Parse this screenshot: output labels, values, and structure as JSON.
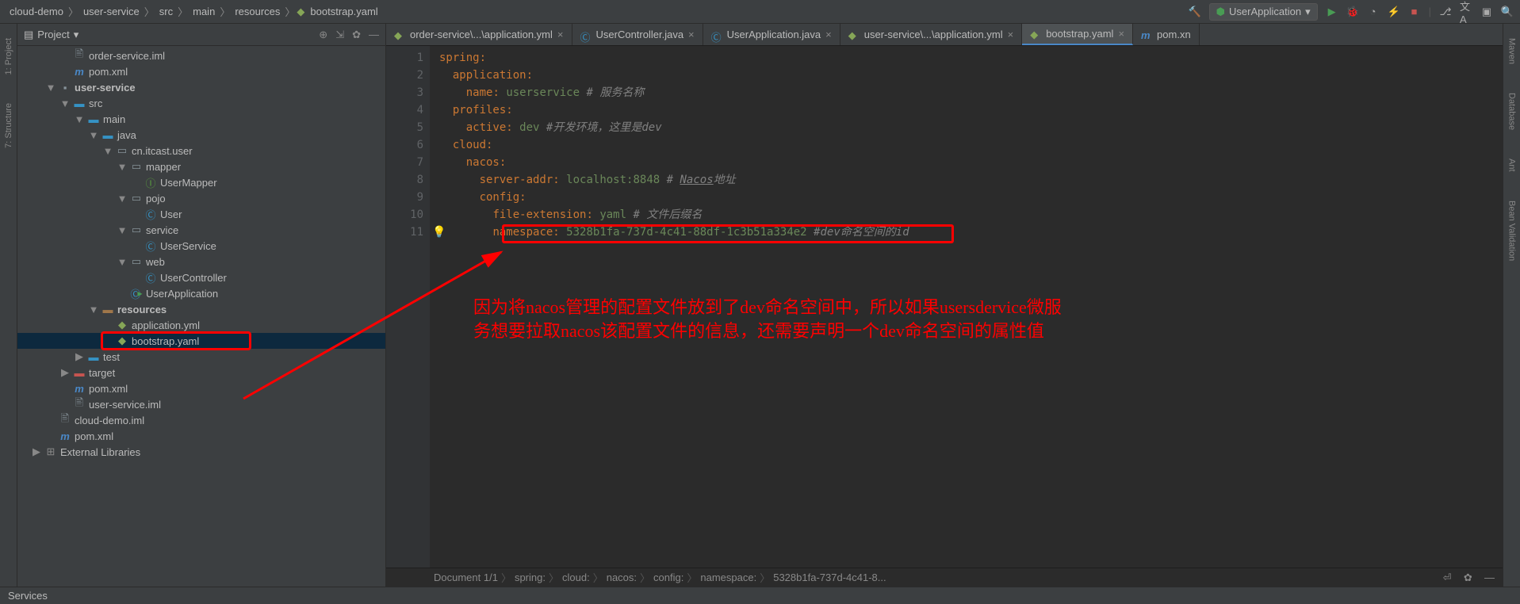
{
  "breadcrumb": [
    "cloud-demo",
    "user-service",
    "src",
    "main",
    "resources",
    "bootstrap.yaml"
  ],
  "run_config": "UserApplication",
  "project_panel": {
    "title": "Project"
  },
  "tree": [
    {
      "d": 3,
      "arrow": "",
      "icon": "folder",
      "label": "order-service.iml"
    },
    {
      "d": 3,
      "arrow": "",
      "icon": "m",
      "label": "pom.xml",
      "color": "#4a88c7"
    },
    {
      "d": 2,
      "arrow": "▼",
      "icon": "module",
      "label": "user-service",
      "bold": true
    },
    {
      "d": 3,
      "arrow": "▼",
      "icon": "src",
      "label": "src"
    },
    {
      "d": 4,
      "arrow": "▼",
      "icon": "src",
      "label": "main"
    },
    {
      "d": 5,
      "arrow": "▼",
      "icon": "src",
      "label": "java"
    },
    {
      "d": 6,
      "arrow": "▼",
      "icon": "pkg",
      "label": "cn.itcast.user"
    },
    {
      "d": 7,
      "arrow": "▼",
      "icon": "pkg",
      "label": "mapper"
    },
    {
      "d": 8,
      "arrow": "",
      "icon": "interface",
      "label": "UserMapper"
    },
    {
      "d": 7,
      "arrow": "▼",
      "icon": "pkg",
      "label": "pojo"
    },
    {
      "d": 8,
      "arrow": "",
      "icon": "class",
      "label": "User"
    },
    {
      "d": 7,
      "arrow": "▼",
      "icon": "pkg",
      "label": "service"
    },
    {
      "d": 8,
      "arrow": "",
      "icon": "class",
      "label": "UserService"
    },
    {
      "d": 7,
      "arrow": "▼",
      "icon": "pkg",
      "label": "web"
    },
    {
      "d": 8,
      "arrow": "",
      "icon": "class",
      "label": "UserController"
    },
    {
      "d": 7,
      "arrow": "",
      "icon": "class-run",
      "label": "UserApplication"
    },
    {
      "d": 5,
      "arrow": "▼",
      "icon": "res",
      "label": "resources",
      "bold": true
    },
    {
      "d": 6,
      "arrow": "",
      "icon": "yaml",
      "label": "application.yml"
    },
    {
      "d": 6,
      "arrow": "",
      "icon": "yaml",
      "label": "bootstrap.yaml",
      "selected": true
    },
    {
      "d": 4,
      "arrow": "▶",
      "icon": "src",
      "label": "test"
    },
    {
      "d": 3,
      "arrow": "▶",
      "icon": "target",
      "label": "target"
    },
    {
      "d": 3,
      "arrow": "",
      "icon": "m",
      "label": "pom.xml",
      "color": "#4a88c7"
    },
    {
      "d": 3,
      "arrow": "",
      "icon": "folder",
      "label": "user-service.iml"
    },
    {
      "d": 2,
      "arrow": "",
      "icon": "folder",
      "label": "cloud-demo.iml"
    },
    {
      "d": 2,
      "arrow": "",
      "icon": "m",
      "label": "pom.xml",
      "color": "#4a88c7"
    },
    {
      "d": 1,
      "arrow": "▶",
      "icon": "lib",
      "label": "External Libraries"
    }
  ],
  "tabs": [
    {
      "icon": "yaml",
      "label": "order-service\\...\\application.yml",
      "close": true
    },
    {
      "icon": "class",
      "label": "UserController.java",
      "close": true
    },
    {
      "icon": "class-run",
      "label": "UserApplication.java",
      "close": true
    },
    {
      "icon": "yaml",
      "label": "user-service\\...\\application.yml",
      "close": true
    },
    {
      "icon": "yaml",
      "label": "bootstrap.yaml",
      "close": true,
      "active": true
    },
    {
      "icon": "m",
      "label": "pom.xn",
      "close": false
    }
  ],
  "code": {
    "lines": [
      {
        "n": 1,
        "html": "<span class='k'>spring</span><span class='col'>:</span>"
      },
      {
        "n": 2,
        "html": "  <span class='k'>application</span><span class='col'>:</span>"
      },
      {
        "n": 3,
        "html": "    <span class='k'>name</span><span class='col'>:</span> <span class='s'>userservice</span> <span class='c'># 服务名称</span>"
      },
      {
        "n": 4,
        "html": "  <span class='k'>profiles</span><span class='col'>:</span>"
      },
      {
        "n": 5,
        "html": "    <span class='k'>active</span><span class='col'>:</span> <span class='s'>dev</span> <span class='c'>#开发环境，这里是dev</span>"
      },
      {
        "n": 6,
        "html": "  <span class='k'>cloud</span><span class='col'>:</span>"
      },
      {
        "n": 7,
        "html": "    <span class='k'>nacos</span><span class='col'>:</span>"
      },
      {
        "n": 8,
        "html": "      <span class='k'>server-addr</span><span class='col'>:</span> <span class='s'>localhost:8848</span> <span class='c'># <span class='u'>Nacos</span>地址</span>"
      },
      {
        "n": 9,
        "html": "      <span class='k'>config</span><span class='col'>:</span>"
      },
      {
        "n": 10,
        "html": "        <span class='k'>file-extension</span><span class='col'>:</span> <span class='s'>yaml</span> <span class='c'># 文件后缀名</span>"
      },
      {
        "n": 11,
        "html": "        <span class='k'>namespace</span><span class='col'>:</span> <span class='s'>5328b1fa-737d-4c41-88df-1c3b51a334e2</span> <span class='c'>#dev命名空间的id</span>",
        "intention": true
      }
    ]
  },
  "editor_breadcrumb": [
    "Document 1/1",
    "spring:",
    "cloud:",
    "nacos:",
    "config:",
    "namespace:",
    "5328b1fa-737d-4c41-8..."
  ],
  "services_label": "Services",
  "left_tabs": [
    "1: Project",
    "7: Structure"
  ],
  "right_tabs": [
    "Maven",
    "Database",
    "Ant",
    "Bean Validation"
  ],
  "annotation": {
    "text1": "因为将nacos管理的配置文件放到了dev命名空间中，所以如果usersdervice微服",
    "text2": "务想要拉取nacos该配置文件的信息，还需要声明一个dev命名空间的属性值"
  }
}
